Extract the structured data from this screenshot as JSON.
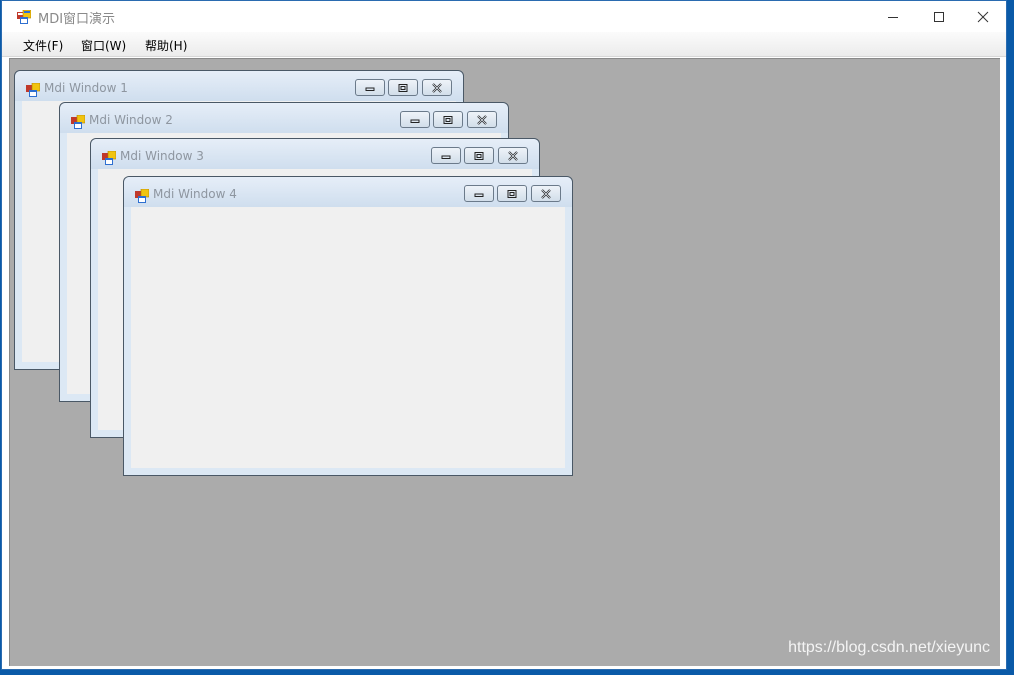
{
  "app": {
    "title": "MDI窗口演示"
  },
  "menu": {
    "items": [
      "文件(F)",
      "窗口(W)",
      "帮助(H)"
    ]
  },
  "children": [
    {
      "title": "Mdi Window 1"
    },
    {
      "title": "Mdi Window 2"
    },
    {
      "title": "Mdi Window 3"
    },
    {
      "title": "Mdi Window 4"
    }
  ],
  "watermark": "https://blog.csdn.net/xieyunc",
  "colors": {
    "desktop": "#0a5aa8",
    "mdi_background": "#ababab",
    "child_frame": "#dce8f4",
    "child_client": "#f0f0f0"
  },
  "icons": {
    "app": "windows-form-icon",
    "minimize": "minimize-icon",
    "maximize": "maximize-icon",
    "restore": "restore-icon",
    "close": "close-icon"
  }
}
